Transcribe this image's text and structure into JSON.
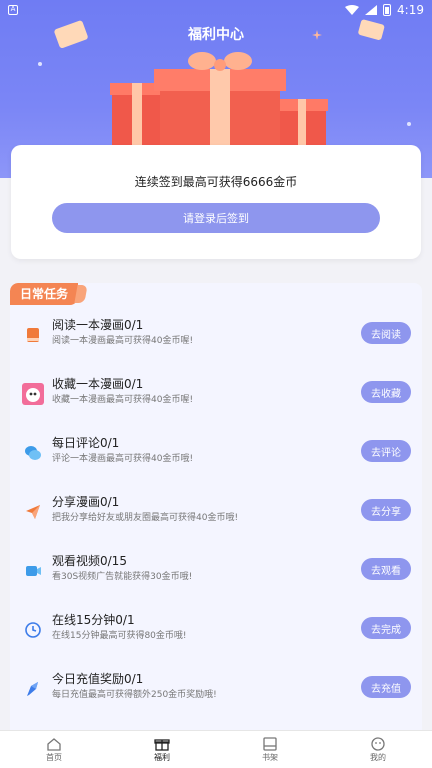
{
  "status_bar": {
    "time": "4:19",
    "notif_icon": "A"
  },
  "header": {
    "title": "福利中心"
  },
  "checkin": {
    "text": "连续签到最高可获得6666金币",
    "button_label": "请登录后签到"
  },
  "tasks": {
    "section_label": "日常任务",
    "items": [
      {
        "title": "阅读一本漫画0/1",
        "desc": "阅读一本漫画最高可获得40金币喔!",
        "button": "去阅读",
        "icon": "book-icon",
        "color": "#f07a3a"
      },
      {
        "title": "收藏一本漫画0/1",
        "desc": "收藏一本漫画最高可获得40金币喔!",
        "button": "去收藏",
        "icon": "bookmark-avatar-icon",
        "color": "#f26d9a"
      },
      {
        "title": "每日评论0/1",
        "desc": "评论一本漫画最高可获得40金币哦!",
        "button": "去评论",
        "icon": "comment-icon",
        "color": "#3d9be9"
      },
      {
        "title": "分享漫画0/1",
        "desc": "把我分享给好友或朋友圈最高可获得40金币哦!",
        "button": "去分享",
        "icon": "share-plane-icon",
        "color": "#f07a3a"
      },
      {
        "title": "观看视频0/15",
        "desc": "看30S视频广告就能获得30金币哦!",
        "button": "去观看",
        "icon": "video-icon",
        "color": "#3d9be9"
      },
      {
        "title": "在线15分钟0/1",
        "desc": "在线15分钟最高可获得80金币哦!",
        "button": "去完成",
        "icon": "clock-icon",
        "color": "#3d7ce9"
      },
      {
        "title": "今日充值奖励0/1",
        "desc": "每日充值最高可获得额外250金币奖励哦!",
        "button": "去充值",
        "icon": "recharge-icon",
        "color": "#3d7ce9"
      }
    ]
  },
  "bottom_nav": {
    "items": [
      {
        "label": "首页",
        "icon": "home-icon"
      },
      {
        "label": "福利",
        "icon": "gift-icon"
      },
      {
        "label": "书架",
        "icon": "bookshelf-icon"
      },
      {
        "label": "我的",
        "icon": "profile-icon"
      }
    ],
    "active_index": 1
  }
}
